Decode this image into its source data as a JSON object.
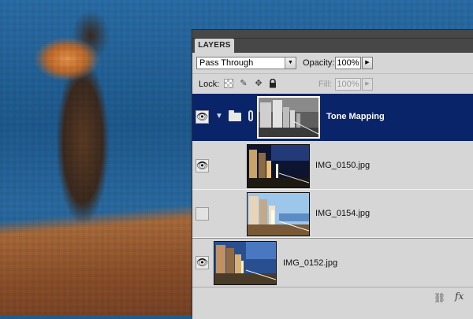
{
  "panel": {
    "tab_label": "LAYERS",
    "blend_mode": "Pass Through",
    "opacity_label": "Opacity:",
    "opacity_value": "100%",
    "lock_label": "Lock:",
    "fill_label": "Fill:",
    "fill_value": "100%"
  },
  "layers": [
    {
      "name": "Tone Mapping",
      "type": "group",
      "visible": true,
      "selected": true,
      "expanded": true
    },
    {
      "name": "IMG_0150.jpg",
      "type": "image",
      "visible": true
    },
    {
      "name": "IMG_0154.jpg",
      "type": "image",
      "visible": false
    },
    {
      "name": "IMG_0152.jpg",
      "type": "image",
      "visible": true
    }
  ],
  "icons": {
    "visibility": "eye-icon",
    "group": "folder-icon",
    "mask_link": "chain-icon",
    "disclosure": "triangle-down-icon",
    "link_layers": "link-icon",
    "layer_style": "fx-icon"
  },
  "colors": {
    "selection": "#0a246a",
    "panel_bg": "#d6d6d6",
    "panel_header": "#474747"
  }
}
